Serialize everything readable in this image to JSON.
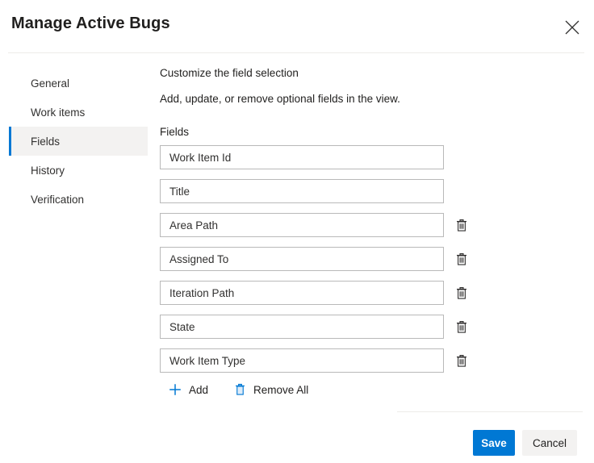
{
  "dialog": {
    "title": "Manage Active Bugs",
    "close_icon": "close-icon"
  },
  "sidebar": {
    "items": [
      {
        "label": "General",
        "selected": false
      },
      {
        "label": "Work items",
        "selected": false
      },
      {
        "label": "Fields",
        "selected": true
      },
      {
        "label": "History",
        "selected": false
      },
      {
        "label": "Verification",
        "selected": false
      }
    ]
  },
  "main": {
    "heading": "Customize the field selection",
    "subheading": "Add, update, or remove optional fields in the view.",
    "fields_label": "Fields",
    "fields": [
      {
        "value": "Work Item Id",
        "deletable": false,
        "delete_icon": "trash-icon"
      },
      {
        "value": "Title",
        "deletable": false,
        "delete_icon": "trash-icon"
      },
      {
        "value": "Area Path",
        "deletable": true,
        "delete_icon": "trash-icon"
      },
      {
        "value": "Assigned To",
        "deletable": true,
        "delete_icon": "trash-icon"
      },
      {
        "value": "Iteration Path",
        "deletable": true,
        "delete_icon": "trash-icon"
      },
      {
        "value": "State",
        "deletable": true,
        "delete_icon": "trash-icon"
      },
      {
        "value": "Work Item Type",
        "deletable": true,
        "delete_icon": "trash-icon"
      }
    ],
    "commands": {
      "add_label": "Add",
      "add_icon": "plus-icon",
      "remove_all_label": "Remove All",
      "remove_all_icon": "trash-icon"
    }
  },
  "footer": {
    "save_label": "Save",
    "cancel_label": "Cancel"
  },
  "colors": {
    "accent": "#0078d4",
    "selected_nav_bg": "#f3f2f1",
    "secondary_button_bg": "#f3f2f1",
    "divider": "#edebe9",
    "input_border": "#b9b9b9",
    "text": "#201f1e"
  }
}
